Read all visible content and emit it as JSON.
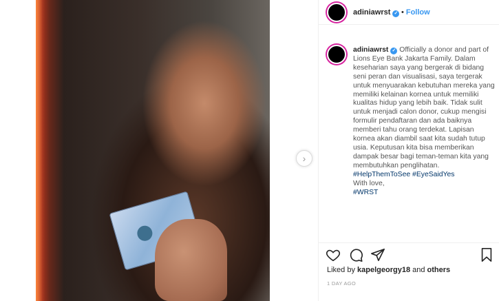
{
  "post": {
    "username": "adiniawrst",
    "follow_label": "Follow",
    "separator": "•",
    "verified_icon": "check",
    "caption_text": "Officially a donor and part of Lions Eye Bank Jakarta Family. Dalam keseharian saya yang bergerak di bidang seni peran dan visualisasi, saya tergerak untuk menyuarakan kebutuhan mereka yang memiliki kelainan kornea untuk memiliki kualitas hidup yang lebih baik. Tidak sulit untuk menjadi calon donor, cukup mengisi formulir pendaftaran dan ada baiknya memberi tahu orang terdekat. Lapisan kornea akan diambil saat kita sudah tutup usia. Keputusan kita bisa memberikan dampak besar bagi teman-teman kita yang membutuhkan penglihatan.",
    "hashtags": "#HelpThemToSee #EyeSaidYes",
    "with_love": "With love,",
    "signoff_tag": "#WRST",
    "likes_prefix": "Liked by ",
    "likes_user": "kapelgeorgy18",
    "likes_suffix": " and ",
    "likes_others": "others",
    "timestamp": "1 DAY AGO",
    "next_arrow": "›"
  },
  "colors": {
    "accent": "#3897f0",
    "hashtag": "#003569",
    "story_ring": "#d6249f"
  },
  "icons": [
    "heart-icon",
    "comment-icon",
    "share-icon",
    "bookmark-icon",
    "verified-icon",
    "chevron-right-icon"
  ]
}
